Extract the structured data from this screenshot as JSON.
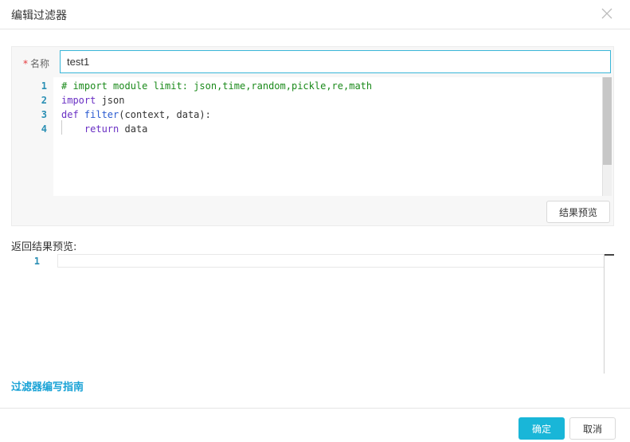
{
  "dialog": {
    "title": "编辑过滤器",
    "close_icon": "close-icon"
  },
  "form": {
    "name_required_mark": "*",
    "name_label": "名称",
    "name_value": "test1"
  },
  "editor": {
    "lines": [
      {
        "number": "1",
        "text": "# import module limit: json,time,random,pickle,re,math"
      },
      {
        "number": "2",
        "keyword": "import",
        "rest": " json"
      },
      {
        "number": "3",
        "keyword": "def",
        "fn": " filter",
        "rest": "(context, data):"
      },
      {
        "number": "4",
        "indent": "    ",
        "keyword": "return",
        "rest": " data"
      }
    ]
  },
  "preview_button_label": "结果预览",
  "result": {
    "label": "返回结果预览:",
    "line_number": "1"
  },
  "guide_link_label": "过滤器编写指南",
  "footer": {
    "ok_label": "确定",
    "cancel_label": "取消"
  },
  "colors": {
    "primary": "#19b6d8",
    "link": "#1aa3d6",
    "comment": "#1b8a1b",
    "keyword": "#6a30c4",
    "required": "#e4393c"
  }
}
